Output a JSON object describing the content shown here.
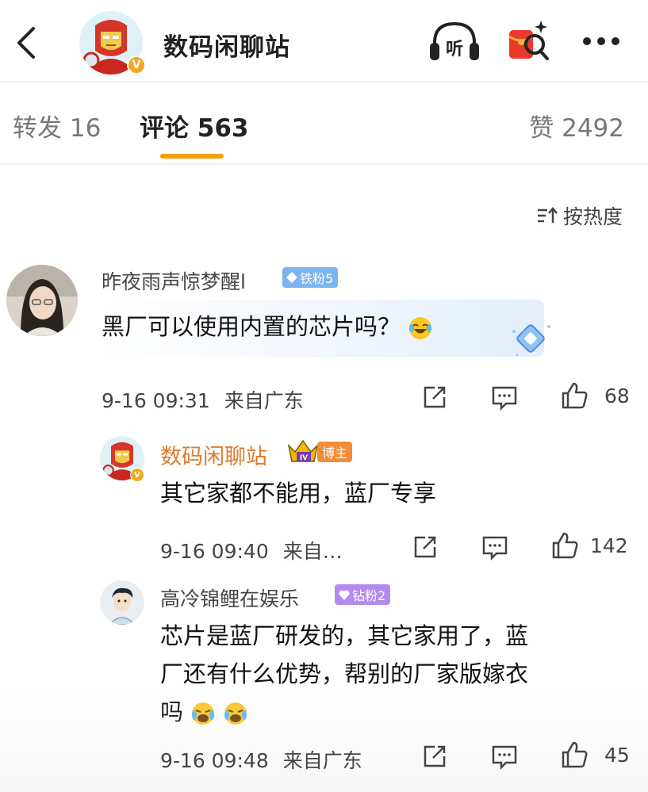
{
  "header": {
    "title": "数码闲聊站",
    "verified_mark": "V",
    "listen_label": "听"
  },
  "tabs": {
    "repost": "转发 16",
    "comments": "评论 563",
    "likes": "赞 2492"
  },
  "sort": {
    "label": "按热度"
  },
  "comments": [
    {
      "username": "昨夜雨声惊梦醒l",
      "fan_badge": "铁粉5",
      "text": "黑厂可以使用内置的芯片吗？",
      "emoji": "laugh-cry",
      "date": "9-16 09:31",
      "location": "来自广东",
      "likes": "68"
    },
    {
      "username": "数码闲聊站",
      "fan_badge": "博主",
      "level_mark": "IV",
      "text": "其它家都不能用，蓝厂专享",
      "date": "9-16 09:40",
      "location": "来自…",
      "likes": "142"
    },
    {
      "username": "高冷锦鲤在娱乐",
      "fan_badge": "钻粉2",
      "text_line1": "芯片是蓝厂研发的，其它家用了，蓝",
      "text_line2": "厂还有什么优势，帮别的厂家版嫁衣",
      "text_line3": "吗",
      "emoji": "crying-laughing",
      "date": "9-16 09:48",
      "location": "来自广东",
      "likes": "45"
    }
  ],
  "colors": {
    "accent": "#f5a000",
    "op_name": "#e07a2c",
    "tie_badge": "#7db3f0",
    "zuan_badge": "#b58af0",
    "bozhu_badge": "#f08c3a"
  }
}
